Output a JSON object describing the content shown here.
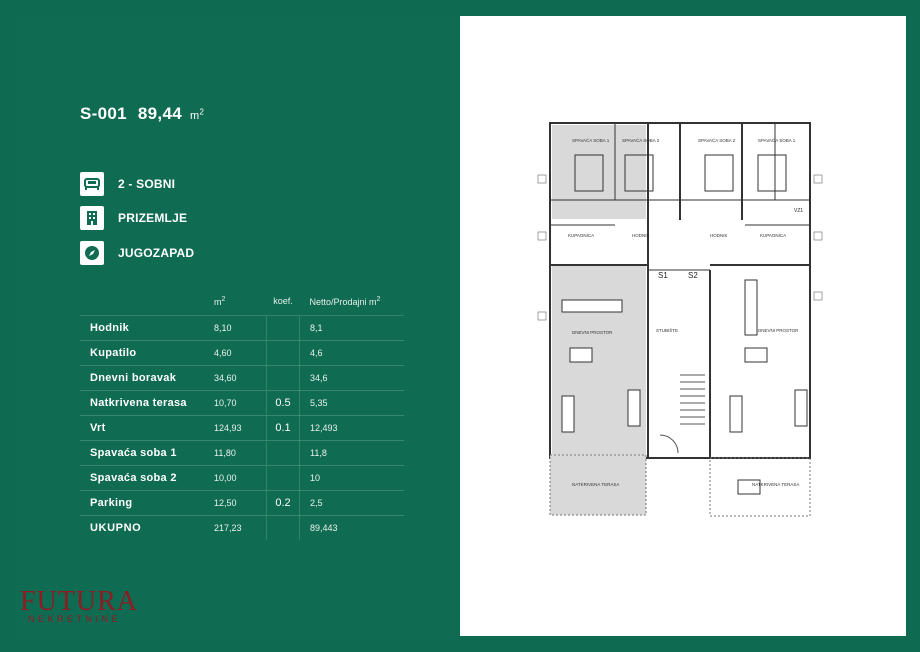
{
  "unit": {
    "code": "S-001",
    "area": "89,44",
    "area_unit": "m",
    "area_exp": "2"
  },
  "features": [
    {
      "icon": "bed-icon",
      "label": "2 - SOBNI"
    },
    {
      "icon": "building-icon",
      "label": "PRIZEMLJE"
    },
    {
      "icon": "compass-icon",
      "label": "JUGOZAPAD"
    }
  ],
  "table": {
    "headers": {
      "m2": "m",
      "m2_exp": "2",
      "koef": "koef.",
      "net": "Netto/Prodajni m",
      "net_exp": "2"
    },
    "rows": [
      {
        "name": "Hodnik",
        "m2": "8,10",
        "koef": "",
        "net": "8,1"
      },
      {
        "name": "Kupatilo",
        "m2": "4,60",
        "koef": "",
        "net": "4,6"
      },
      {
        "name": "Dnevni boravak",
        "m2": "34,60",
        "koef": "",
        "net": "34,6"
      },
      {
        "name": "Natkrivena terasa",
        "m2": "10,70",
        "koef": "0.5",
        "net": "5,35"
      },
      {
        "name": "Vrt",
        "m2": "124,93",
        "koef": "0.1",
        "net": "12,493"
      },
      {
        "name": "Spavaća soba 1",
        "m2": "11,80",
        "koef": "",
        "net": "11,8"
      },
      {
        "name": "Spavaća soba 2",
        "m2": "10,00",
        "koef": "",
        "net": "10"
      },
      {
        "name": "Parking",
        "m2": "12,50",
        "koef": "0.2",
        "net": "2,5"
      }
    ],
    "total": {
      "name": "UKUPNO",
      "m2": "217,23",
      "koef": "",
      "net": "89,443"
    }
  },
  "logo": {
    "word": "FUTURA",
    "sub": "NEKRETNINE"
  },
  "plan": {
    "labels": {
      "room_bed1": "SPAVAĆA SOBA 1",
      "room_bed2": "SPAVAĆA SOBA 2",
      "room_bath": "KUPAONICA",
      "room_hall": "HODNIK",
      "room_living": "DNEVNI PROSTOR",
      "room_stairs": "STUBIŠTE",
      "room_terrace": "NATKRIVENA TERASA",
      "s1": "S1",
      "s2": "S2",
      "vz1": "VZ1"
    }
  },
  "colors": {
    "background": "#0f6b51",
    "panel": "#ffffff",
    "logo": "#8b1d23",
    "plan_fill": "#d9d9d9"
  }
}
